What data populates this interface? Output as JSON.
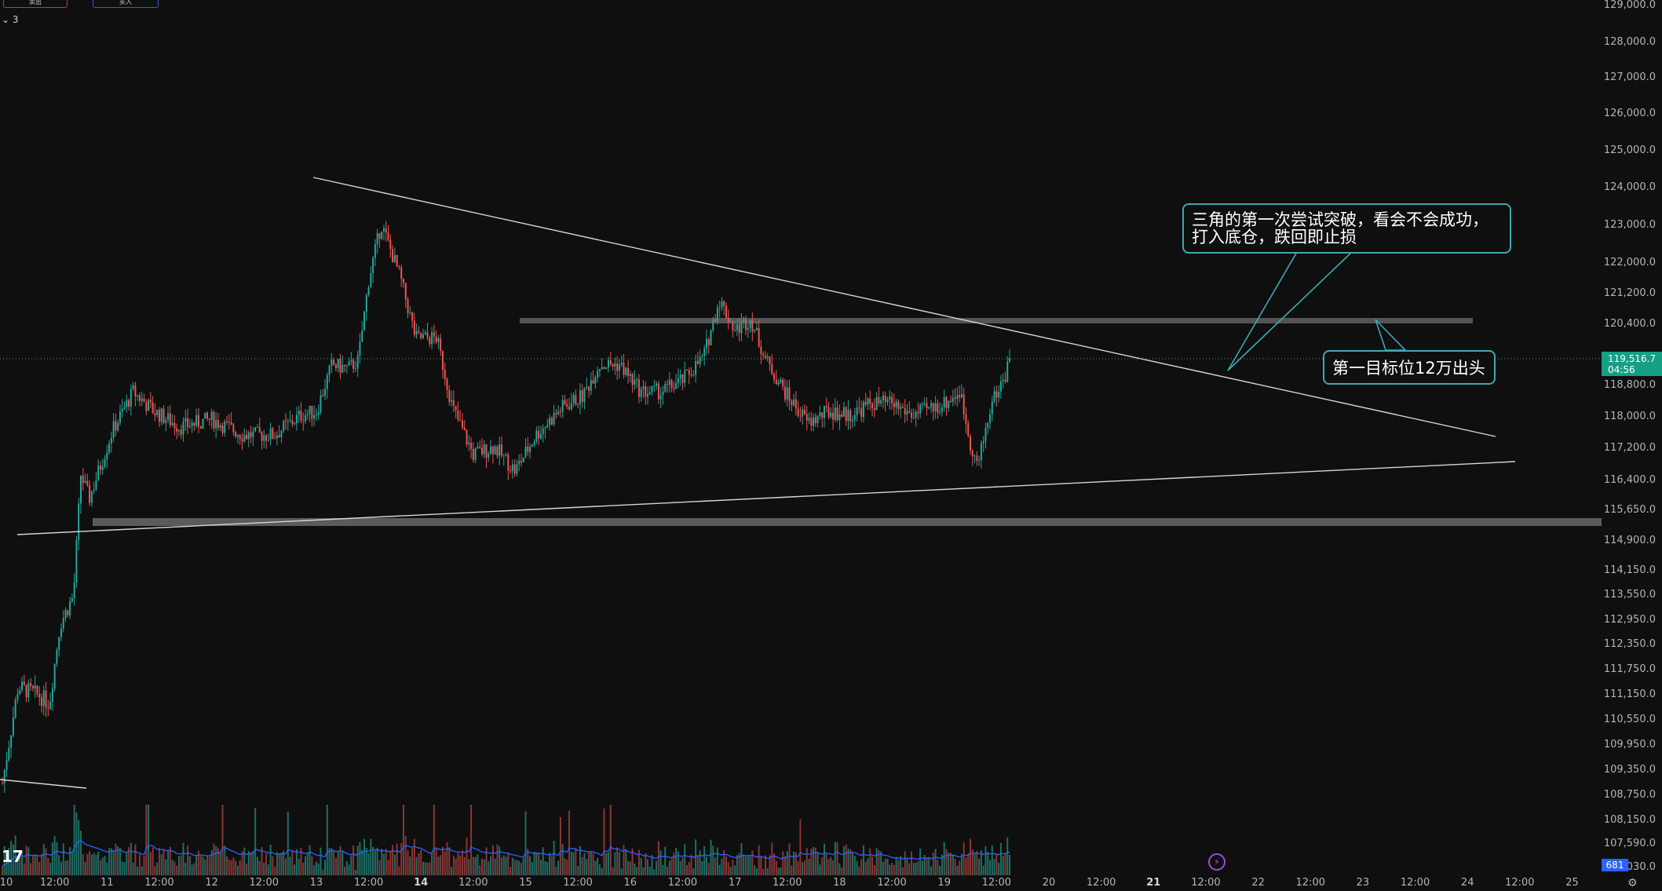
{
  "header": {
    "sell_label": "卖出",
    "buy_label": "买入",
    "indicator_count": "3"
  },
  "annotations": {
    "box1_line1": "三角的第一次尝试突破，看会不会成功，",
    "box1_line2": "打入底仓，跌回即止损",
    "box2": "第一目标位12万出头"
  },
  "price_tag": {
    "price": "119,516.7",
    "countdown": "04:56"
  },
  "volume_tag": "681",
  "icons": {
    "logo": "tradingview-logo-icon",
    "alert": "lightning-icon",
    "settings": "gear-icon"
  },
  "colors": {
    "up": "#26a69a",
    "down": "#ef5350",
    "background": "#0f0f0f",
    "annotation_border": "#3fa7b5",
    "volume_ma": "#2962ff"
  },
  "chart_data": {
    "type": "candlestick",
    "instrument": "",
    "y_scale": "log",
    "ylim": [
      107000,
      129000
    ],
    "price_ticks": [
      "129,000.0",
      "128,000.0",
      "127,000.0",
      "126,000.0",
      "125,000.0",
      "124,000.0",
      "123,000.0",
      "122,000.0",
      "121,200.0",
      "120,400.0",
      "118,800.0",
      "118,000.0",
      "117,200.0",
      "116,400.0",
      "115,650.0",
      "114,900.0",
      "114,150.0",
      "113,550.0",
      "112,950.0",
      "112,350.0",
      "111,750.0",
      "111,150.0",
      "110,550.0",
      "109,950.0",
      "109,350.0",
      "108,750.0",
      "108,150.0",
      "107,590.0",
      "107,030.0"
    ],
    "time_ticks": [
      "10",
      "12:00",
      "11",
      "12:00",
      "12",
      "12:00",
      "13",
      "12:00",
      "14",
      "12:00",
      "15",
      "12:00",
      "16",
      "12:00",
      "17",
      "12:00",
      "18",
      "12:00",
      "19",
      "12:00",
      "20",
      "12:00",
      "21",
      "12:00",
      "22",
      "12:00",
      "23",
      "12:00",
      "24",
      "12:00",
      "25"
    ],
    "bold_time_ticks": [
      "14",
      "21"
    ],
    "price_path": [
      {
        "t": 0.0,
        "p": 109000
      },
      {
        "t": 0.15,
        "p": 111300
      },
      {
        "t": 0.35,
        "p": 111100
      },
      {
        "t": 0.45,
        "p": 110900
      },
      {
        "t": 0.55,
        "p": 112800
      },
      {
        "t": 0.68,
        "p": 113500
      },
      {
        "t": 0.75,
        "p": 116500
      },
      {
        "t": 0.83,
        "p": 115900
      },
      {
        "t": 1.05,
        "p": 117600
      },
      {
        "t": 1.25,
        "p": 118600
      },
      {
        "t": 1.45,
        "p": 118100
      },
      {
        "t": 1.7,
        "p": 117700
      },
      {
        "t": 2.0,
        "p": 117900
      },
      {
        "t": 2.3,
        "p": 117500
      },
      {
        "t": 2.6,
        "p": 117500
      },
      {
        "t": 2.85,
        "p": 118000
      },
      {
        "t": 3.0,
        "p": 118100
      },
      {
        "t": 3.15,
        "p": 119300
      },
      {
        "t": 3.3,
        "p": 119200
      },
      {
        "t": 3.4,
        "p": 119400
      },
      {
        "t": 3.5,
        "p": 121500
      },
      {
        "t": 3.62,
        "p": 123000
      },
      {
        "t": 3.8,
        "p": 121600
      },
      {
        "t": 3.95,
        "p": 120000
      },
      {
        "t": 4.15,
        "p": 120000
      },
      {
        "t": 4.3,
        "p": 118200
      },
      {
        "t": 4.5,
        "p": 117000
      },
      {
        "t": 4.7,
        "p": 117200
      },
      {
        "t": 4.9,
        "p": 116600
      },
      {
        "t": 5.1,
        "p": 117500
      },
      {
        "t": 5.35,
        "p": 118200
      },
      {
        "t": 5.55,
        "p": 118500
      },
      {
        "t": 5.7,
        "p": 119300
      },
      {
        "t": 5.9,
        "p": 119300
      },
      {
        "t": 6.1,
        "p": 118600
      },
      {
        "t": 6.3,
        "p": 118600
      },
      {
        "t": 6.5,
        "p": 118900
      },
      {
        "t": 6.7,
        "p": 119500
      },
      {
        "t": 6.85,
        "p": 121000
      },
      {
        "t": 7.0,
        "p": 120200
      },
      {
        "t": 7.15,
        "p": 120500
      },
      {
        "t": 7.3,
        "p": 119400
      },
      {
        "t": 7.5,
        "p": 118500
      },
      {
        "t": 7.7,
        "p": 117800
      },
      {
        "t": 7.9,
        "p": 118100
      },
      {
        "t": 8.1,
        "p": 118000
      },
      {
        "t": 8.3,
        "p": 118300
      },
      {
        "t": 8.5,
        "p": 118300
      },
      {
        "t": 8.7,
        "p": 118000
      },
      {
        "t": 8.9,
        "p": 118200
      },
      {
        "t": 9.0,
        "p": 118300
      },
      {
        "t": 9.15,
        "p": 118600
      },
      {
        "t": 9.25,
        "p": 117300
      },
      {
        "t": 9.32,
        "p": 116700
      },
      {
        "t": 9.45,
        "p": 118300
      },
      {
        "t": 9.58,
        "p": 119000
      },
      {
        "t": 9.63,
        "p": 119516.7
      }
    ]
  }
}
